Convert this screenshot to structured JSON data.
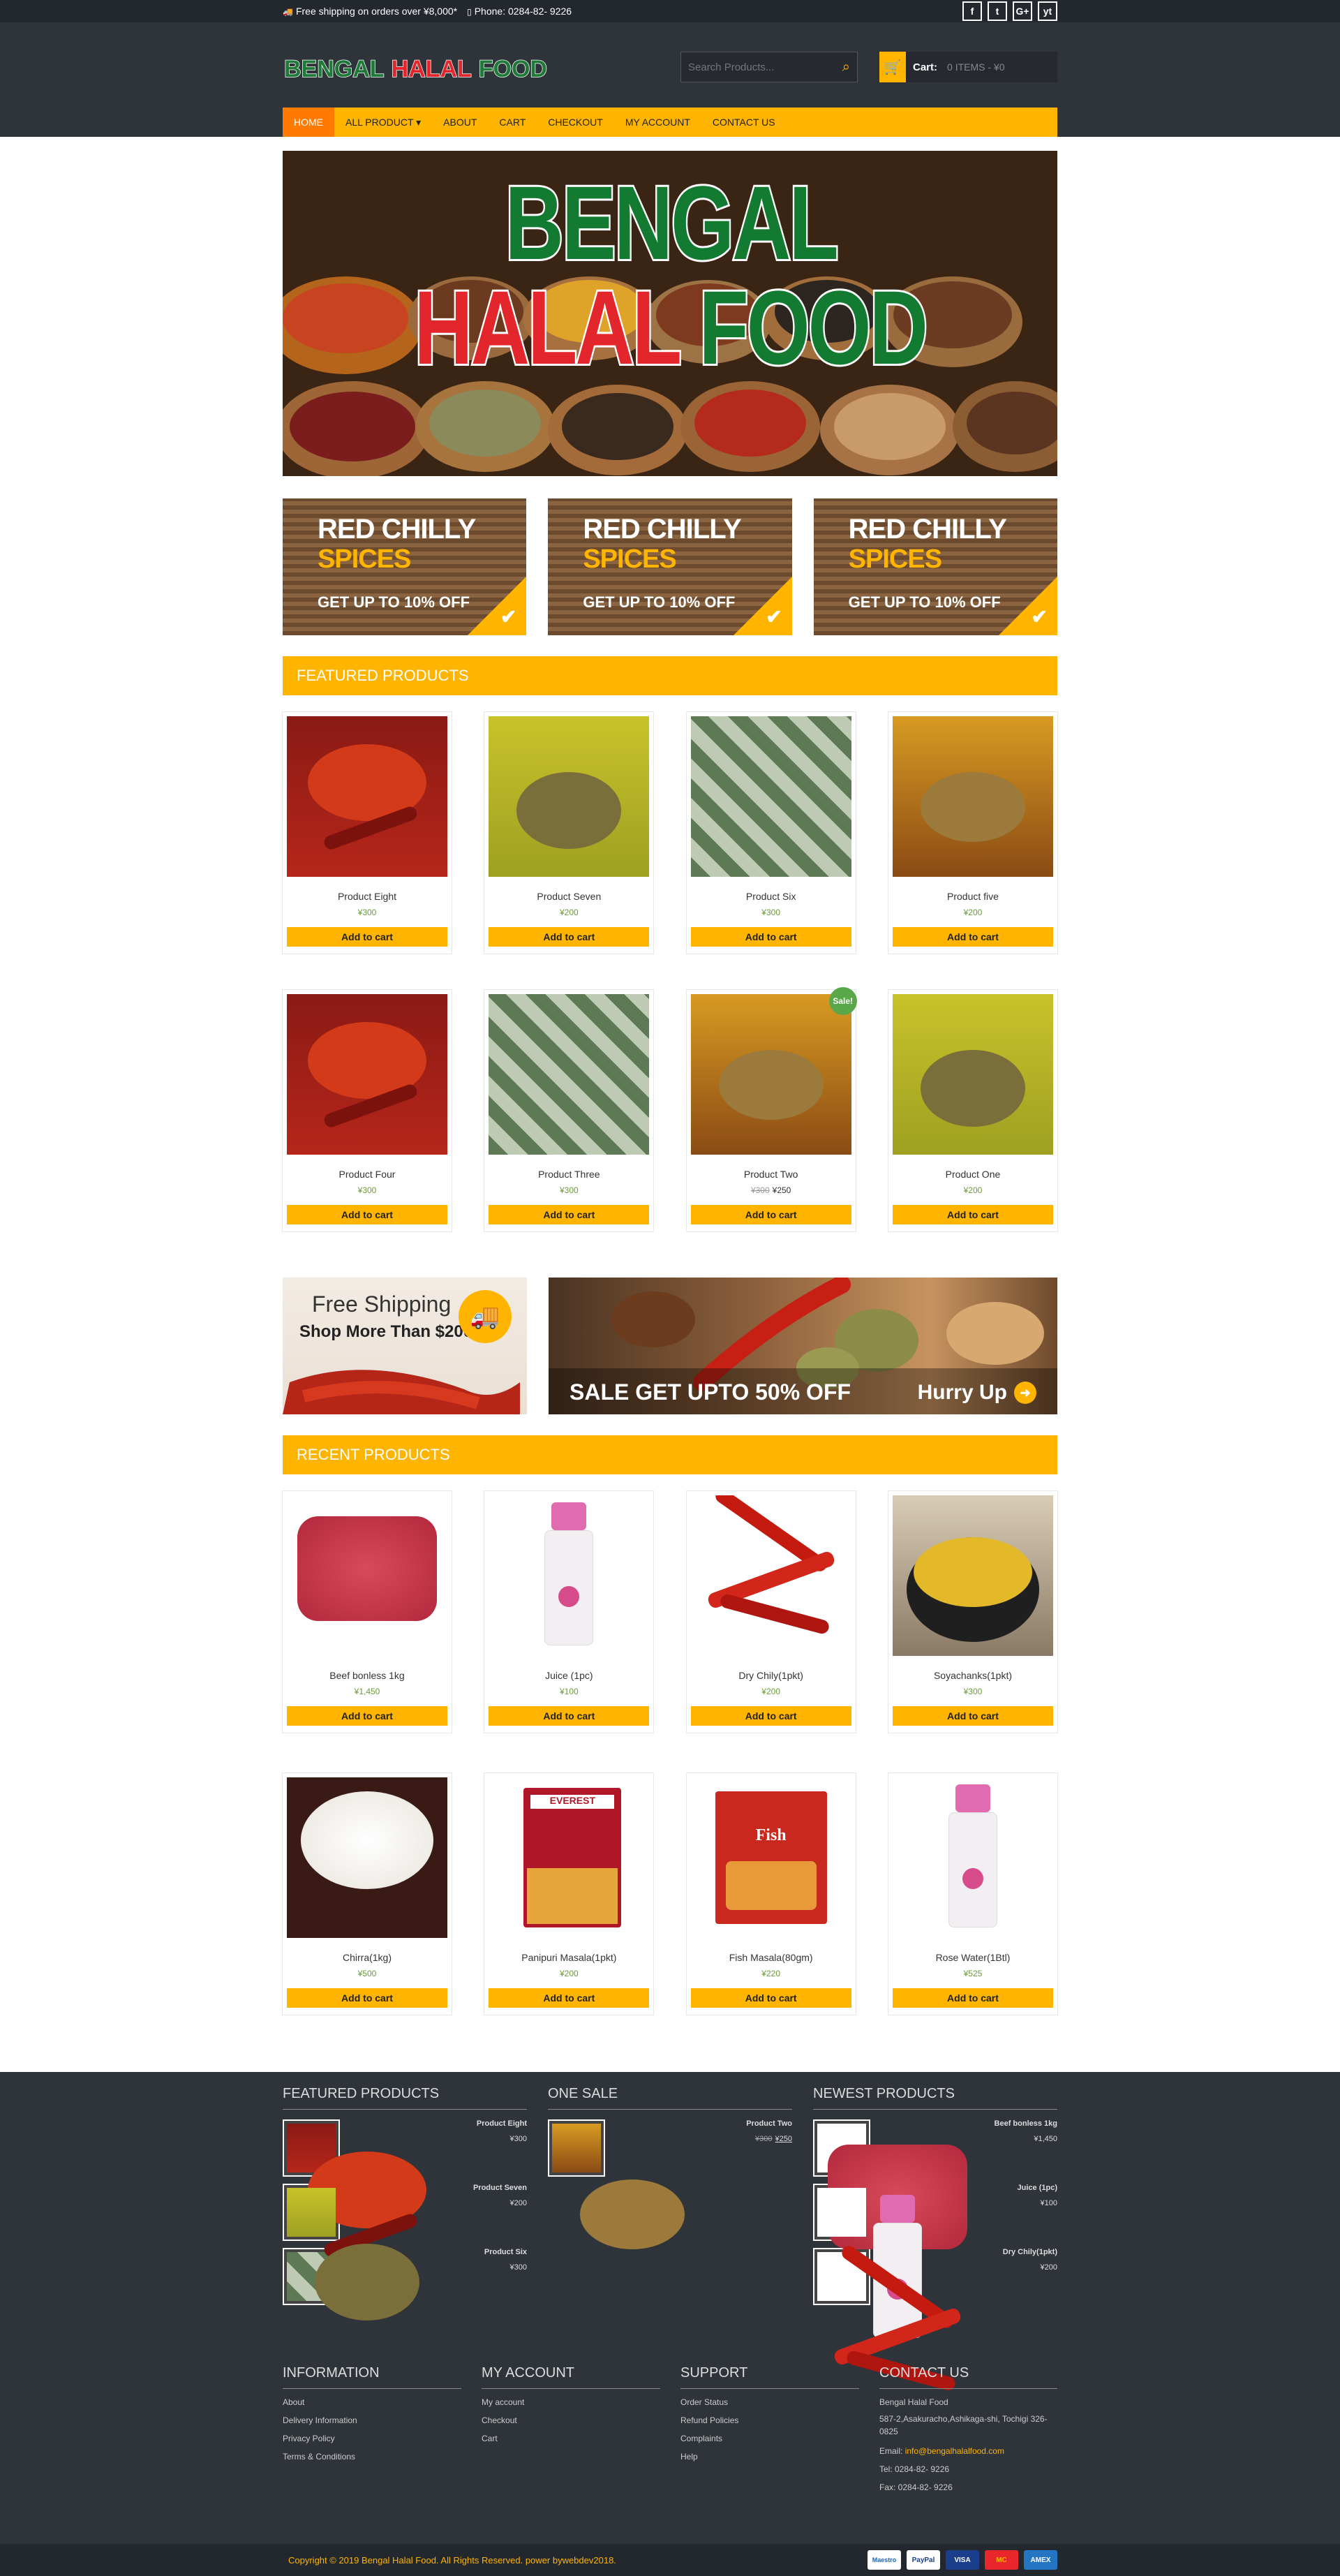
{
  "topbar": {
    "shipping": "Free shipping on orders over ¥8,000*",
    "phone": "Phone: 0284-82- 9226",
    "socials": [
      "f",
      "t",
      "G+",
      "yt"
    ]
  },
  "header": {
    "logo_words": [
      "BENGAL",
      "HALAL",
      "FOOD"
    ],
    "search_placeholder": "Search Products...",
    "cart_label": "Cart:",
    "cart_value": "0 ITEMS - ¥0"
  },
  "nav": [
    "HOME",
    "ALL PRODUCT ▾",
    "ABOUT",
    "CART",
    "CHECKOUT",
    "MY ACCOUNT",
    "CONTACT US"
  ],
  "hero": {
    "words": [
      "BENGAL",
      "HALAL",
      "FOOD"
    ]
  },
  "promo": {
    "line1": "RED CHILLY",
    "line2": "SPICES",
    "line3": "GET UP TO 10% OFF"
  },
  "featured": {
    "title": "FEATURED PRODUCTS",
    "products": [
      {
        "name": "Product Eight",
        "price": "¥300",
        "btn": "Add to cart",
        "img": "chili"
      },
      {
        "name": "Product Seven",
        "price": "¥200",
        "btn": "Add to cart",
        "img": "cumin"
      },
      {
        "name": "Product Six",
        "price": "¥300",
        "btn": "Add to cart",
        "img": "packs"
      },
      {
        "name": "Product five",
        "price": "¥200",
        "btn": "Add to cart",
        "img": "coriander"
      },
      {
        "name": "Product Four",
        "price": "¥300",
        "btn": "Add to cart",
        "img": "chili"
      },
      {
        "name": "Product Three",
        "price": "¥300",
        "btn": "Add to cart",
        "img": "packs"
      },
      {
        "name": "Product Two",
        "old_price": "¥300",
        "price": "¥250",
        "btn": "Add to cart",
        "img": "coriander",
        "badge": "Sale!"
      },
      {
        "name": "Product One",
        "price": "¥200",
        "btn": "Add to cart",
        "img": "cumin"
      }
    ]
  },
  "banners": {
    "left_title": "Free Shipping",
    "left_sub": "Shop More Than $200",
    "right_text": "SALE GET UPTO 50% OFF",
    "right_cta": "Hurry Up"
  },
  "recent": {
    "title": "RECENT PRODUCTS",
    "products": [
      {
        "name": "Beef bonless 1kg",
        "price": "¥1,450",
        "btn": "Add to cart",
        "img": "beef"
      },
      {
        "name": "Juice (1pc)",
        "price": "¥100",
        "btn": "Add to cart",
        "img": "bottle"
      },
      {
        "name": "Dry Chily(1pkt)",
        "price": "¥200",
        "btn": "Add to cart",
        "img": "redchili"
      },
      {
        "name": "Soyachanks(1pkt)",
        "price": "¥300",
        "btn": "Add to cart",
        "img": "rice"
      },
      {
        "name": "Chirra(1kg)",
        "price": "¥500",
        "btn": "Add to cart",
        "img": "chirra"
      },
      {
        "name": "Panipuri Masala(1pkt)",
        "price": "¥200",
        "btn": "Add to cart",
        "img": "everest"
      },
      {
        "name": "Fish Masala(80gm)",
        "price": "¥220",
        "btn": "Add to cart",
        "img": "fish"
      },
      {
        "name": "Rose Water(1Btl)",
        "price": "¥525",
        "btn": "Add to cart",
        "img": "bottle"
      }
    ]
  },
  "footer": {
    "featured_title": "FEATURED PRODUCTS",
    "featured": [
      {
        "name": "Product Eight",
        "price": "¥300",
        "img": "chili"
      },
      {
        "name": "Product Seven",
        "price": "¥200",
        "img": "cumin"
      },
      {
        "name": "Product Six",
        "price": "¥300",
        "img": "packs"
      }
    ],
    "sale_title": "ONE SALE",
    "sale": [
      {
        "name": "Product Two",
        "old_price": "¥300",
        "price": "¥250",
        "img": "coriander"
      }
    ],
    "newest_title": "NEWEST PRODUCTS",
    "newest": [
      {
        "name": "Beef bonless 1kg",
        "price": "¥1,450",
        "img": "beef"
      },
      {
        "name": "Juice (1pc)",
        "price": "¥100",
        "img": "bottle"
      },
      {
        "name": "Dry Chily(1pkt)",
        "price": "¥200",
        "img": "redchili"
      }
    ],
    "information": {
      "title": "INFORMATION",
      "links": [
        "About",
        "Delivery Information",
        "Privacy Policy",
        "Terms & Conditions"
      ]
    },
    "account": {
      "title": "MY ACCOUNT",
      "links": [
        "My account",
        "Checkout",
        "Cart"
      ]
    },
    "support": {
      "title": "SUPPORT",
      "links": [
        "Order Status",
        "Refund Policies",
        "Complaints",
        "Help"
      ]
    },
    "contact": {
      "title": "CONTACT US",
      "company": "Bengal Halal Food",
      "address": "587-2,Asakuracho,Ashikaga-shi, Tochigi 326-0825",
      "email_label": "Email:",
      "email": "info@bengalhalalfood.com",
      "tel": "Tel: 0284-82- 9226",
      "fax": "Fax: 0284-82- 9226"
    }
  },
  "bottom": {
    "copyright": "Copyright © 2019 Bengal Halal Food. All Rights Reserved. power bywebdev2018.",
    "payments": [
      "Maestro",
      "PayPal",
      "VISA",
      "MC",
      "AMEX"
    ]
  },
  "colors": {
    "accent": "#ffb400",
    "nav_active": "#ff7a00",
    "dark": "#2f333a",
    "darker": "#23272e"
  }
}
